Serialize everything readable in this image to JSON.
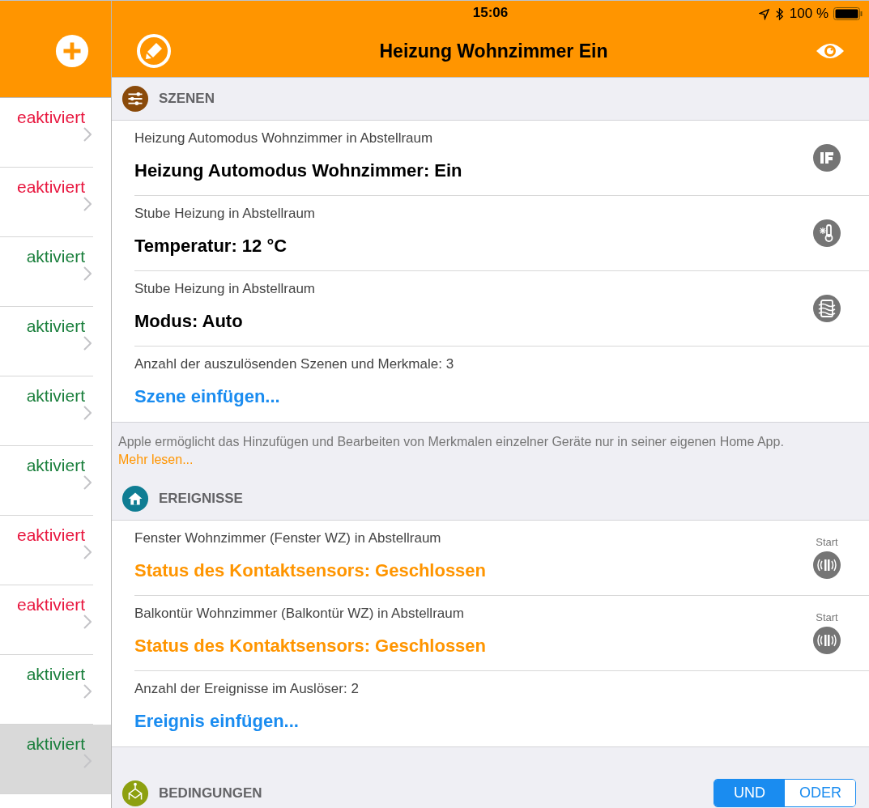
{
  "status_bar": {
    "time": "15:06",
    "battery": "100 %"
  },
  "sidebar": {
    "items": [
      {
        "status": "eaktiviert",
        "color": "#e8173f",
        "selected": false
      },
      {
        "status": "eaktiviert",
        "color": "#e8173f",
        "selected": false
      },
      {
        "status": "aktiviert",
        "color": "#1a7f3c",
        "selected": false
      },
      {
        "status": "aktiviert",
        "color": "#1a7f3c",
        "selected": false
      },
      {
        "status": "aktiviert",
        "color": "#1a7f3c",
        "selected": false
      },
      {
        "status": "aktiviert",
        "color": "#1a7f3c",
        "selected": false
      },
      {
        "status": "eaktiviert",
        "color": "#e8173f",
        "selected": false
      },
      {
        "status": "eaktiviert",
        "color": "#e8173f",
        "selected": false
      },
      {
        "status": "aktiviert",
        "color": "#1a7f3c",
        "selected": false
      },
      {
        "status": "aktiviert",
        "color": "#1a7f3c",
        "selected": true
      }
    ]
  },
  "nav": {
    "title": "Heizung Wohnzimmer Ein"
  },
  "scenes": {
    "title": "SZENEN",
    "rows": [
      {
        "subtitle": "Heizung Automodus Wohnzimmer in Abstellraum",
        "value": "Heizung Automodus Wohnzimmer: Ein",
        "kind": "logic"
      },
      {
        "subtitle": "Stube Heizung in Abstellraum",
        "value": "Temperatur: 12 °C",
        "kind": "temperature"
      },
      {
        "subtitle": "Stube Heizung in Abstellraum",
        "value": "Modus: Auto",
        "kind": "mode"
      }
    ],
    "count": "Anzahl der auszulösenden Szenen und Merkmale: 3",
    "add": "Szene einfügen..."
  },
  "note": {
    "text": "Apple ermöglicht das Hinzufügen und Bearbeiten von Merkmalen einzelner Geräte nur in seiner eigenen Home App.",
    "link": "Mehr lesen..."
  },
  "events": {
    "title": "EREIGNISSE",
    "rows": [
      {
        "subtitle": "Fenster Wohnzimmer (Fenster WZ) in Abstellraum",
        "value": "Status des Kontaktsensors: Geschlossen",
        "badge": "Start",
        "kind": "contact"
      },
      {
        "subtitle": "Balkontür Wohnzimmer (Balkontür WZ) in Abstellraum",
        "value": "Status des Kontaktsensors: Geschlossen",
        "badge": "Start",
        "kind": "contact"
      }
    ],
    "count": "Anzahl der Ereignisse im Auslöser: 2",
    "add": "Ereignis einfügen..."
  },
  "conditions": {
    "title": "BEDINGUNGEN",
    "options": [
      {
        "label": "UND",
        "selected": true
      },
      {
        "label": "ODER",
        "selected": false
      }
    ]
  }
}
